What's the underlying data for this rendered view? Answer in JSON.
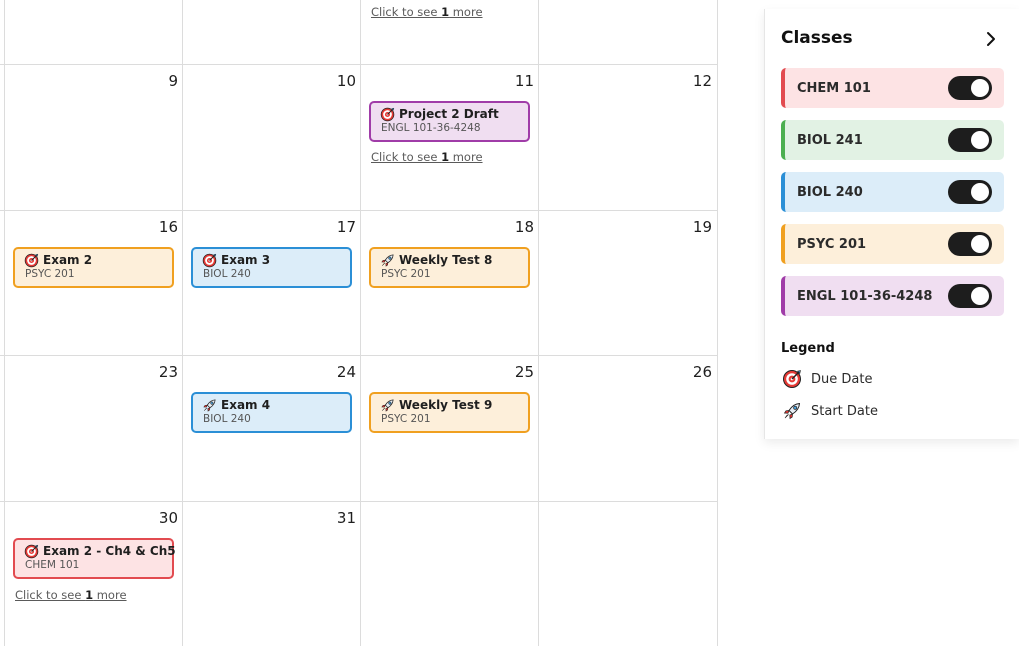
{
  "calendar": {
    "more_prefix": "Click to see ",
    "more_suffix": " more",
    "more_count": "1",
    "days": [
      "9",
      "10",
      "11",
      "12",
      "16",
      "17",
      "18",
      "19",
      "23",
      "24",
      "25",
      "26",
      "30",
      "31"
    ],
    "events": [
      {
        "title": "Project 2 Draft",
        "class": "ENGL 101-36-4248",
        "icon": "target-icon"
      },
      {
        "title": "Exam 2",
        "class": "PSYC 201",
        "icon": "target-icon"
      },
      {
        "title": "Exam 3",
        "class": "BIOL 240",
        "icon": "target-icon"
      },
      {
        "title": "Weekly Test 8",
        "class": "PSYC 201",
        "icon": "rocket-icon"
      },
      {
        "title": "Exam 4",
        "class": "BIOL 240",
        "icon": "rocket-icon"
      },
      {
        "title": "Weekly Test 9",
        "class": "PSYC 201",
        "icon": "rocket-icon"
      },
      {
        "title": "Exam 2 - Ch4 & Ch5",
        "class": "CHEM 101",
        "icon": "target-icon"
      }
    ]
  },
  "sidebar": {
    "title": "Classes",
    "classes": [
      {
        "label": "CHEM 101",
        "color": "#e24b50",
        "enabled": true
      },
      {
        "label": "BIOL 241",
        "color": "#4caf50",
        "enabled": true
      },
      {
        "label": "BIOL 240",
        "color": "#2b8fd6",
        "enabled": true
      },
      {
        "label": "PSYC 201",
        "color": "#f0a020",
        "enabled": true
      },
      {
        "label": "ENGL 101-36-4248",
        "color": "#a03ca8",
        "enabled": true
      }
    ],
    "legend": {
      "title": "Legend",
      "items": [
        {
          "label": "Due Date",
          "icon": "target-icon"
        },
        {
          "label": "Start Date",
          "icon": "rocket-icon"
        }
      ]
    }
  }
}
